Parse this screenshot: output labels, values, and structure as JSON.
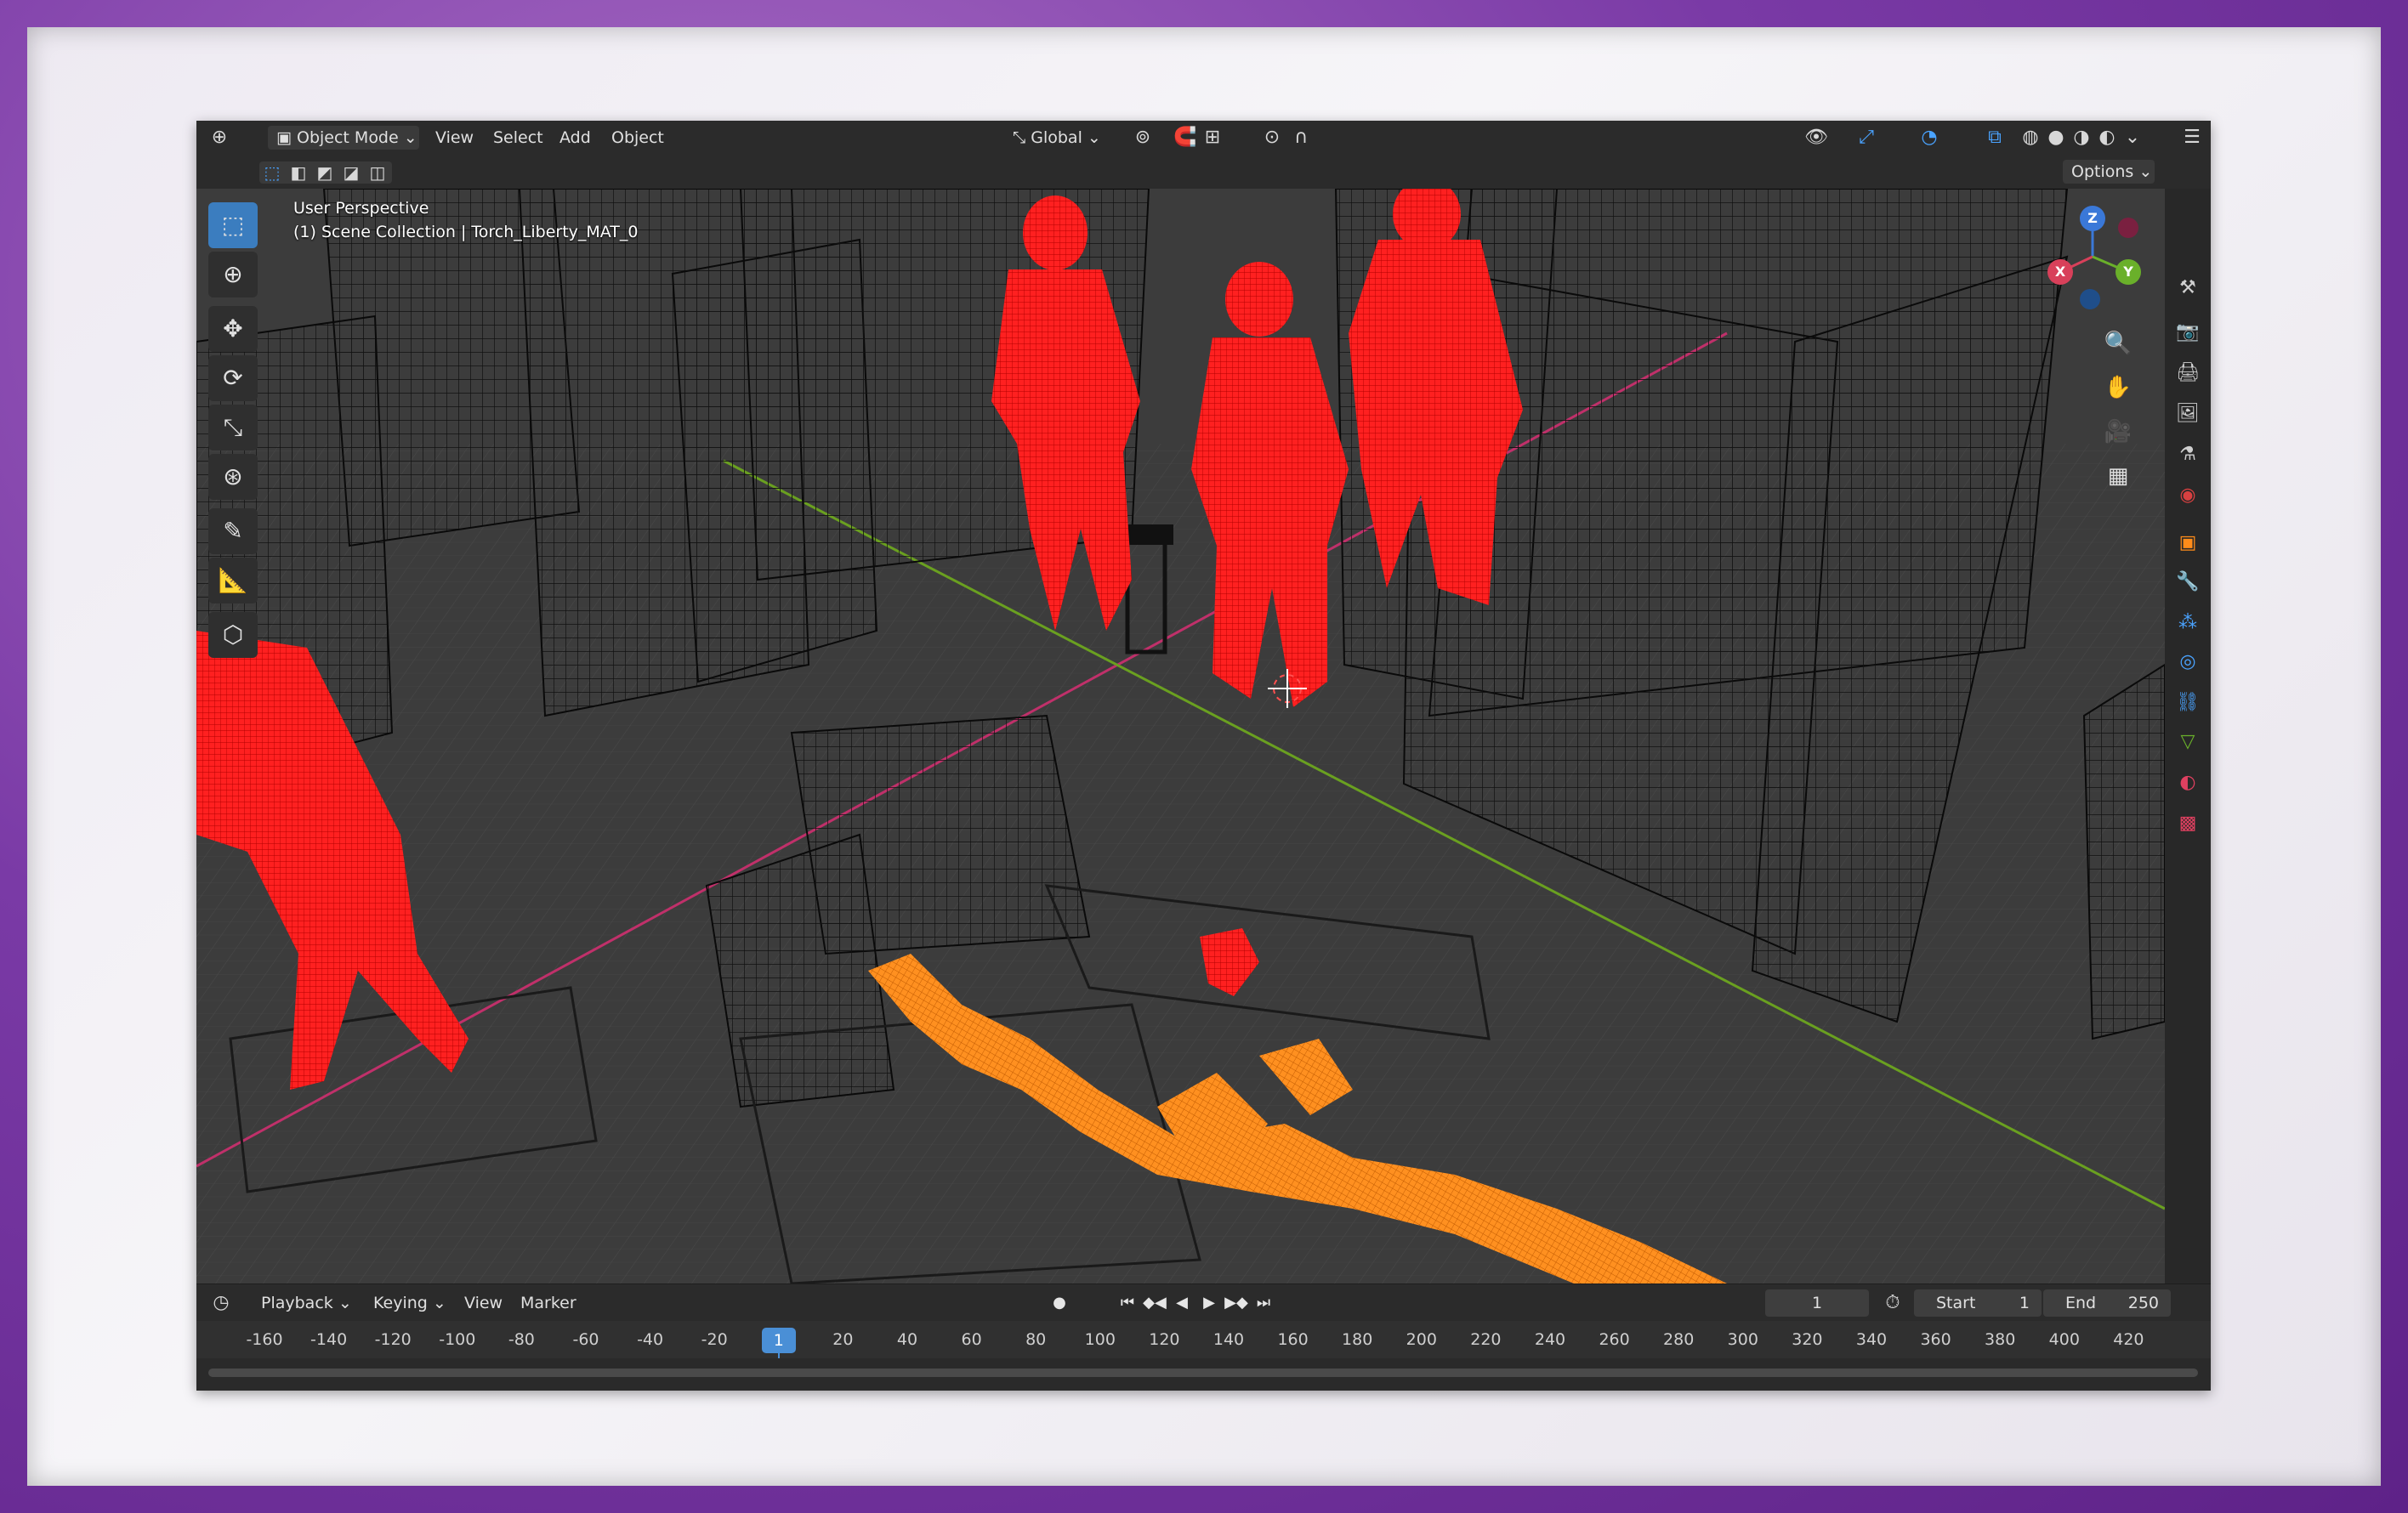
{
  "header": {
    "mode": "Object Mode",
    "menus": [
      "View",
      "Select",
      "Add",
      "Object"
    ],
    "transform_orientation": "Global",
    "options_label": "Options"
  },
  "viewport": {
    "overlay_line1": "User Perspective",
    "overlay_line2": "(1) Scene Collection | Torch_Liberty_MAT_0"
  },
  "gizmo": {
    "z": "Z",
    "x": "X",
    "y": "Y"
  },
  "timeline": {
    "menus": [
      "Playback",
      "Keying",
      "View",
      "Marker"
    ],
    "current_frame": "1",
    "start_label": "Start",
    "start_value": "1",
    "end_label": "End",
    "end_value": "250",
    "ruler_ticks": [
      "-160",
      "-140",
      "-120",
      "-100",
      "-80",
      "-60",
      "-40",
      "-20",
      "1",
      "20",
      "40",
      "60",
      "80",
      "100",
      "120",
      "140",
      "160",
      "180",
      "200",
      "220",
      "240",
      "260",
      "280",
      "300",
      "320",
      "340",
      "360",
      "380",
      "400",
      "420"
    ]
  },
  "colors": {
    "selected_objects": "#ff1a1a",
    "active_object": "#ff8c1a",
    "x_axis": "#c0306a",
    "y_axis": "#6aa020",
    "accent": "#4a8fd6"
  },
  "icons": {
    "toolbar": [
      "select-box-icon",
      "cursor-icon",
      "move-icon",
      "rotate-icon",
      "scale-icon",
      "transform-icon",
      "annotate-icon",
      "measure-icon",
      "add-cube-icon"
    ],
    "right_strip": [
      "tool-settings-icon",
      "render-icon",
      "output-icon",
      "view-layer-icon",
      "scene-icon",
      "world-icon",
      "object-icon",
      "modifier-icon",
      "particles-icon",
      "physics-icon",
      "constraints-icon",
      "data-icon",
      "material-icon",
      "texture-icon"
    ]
  }
}
